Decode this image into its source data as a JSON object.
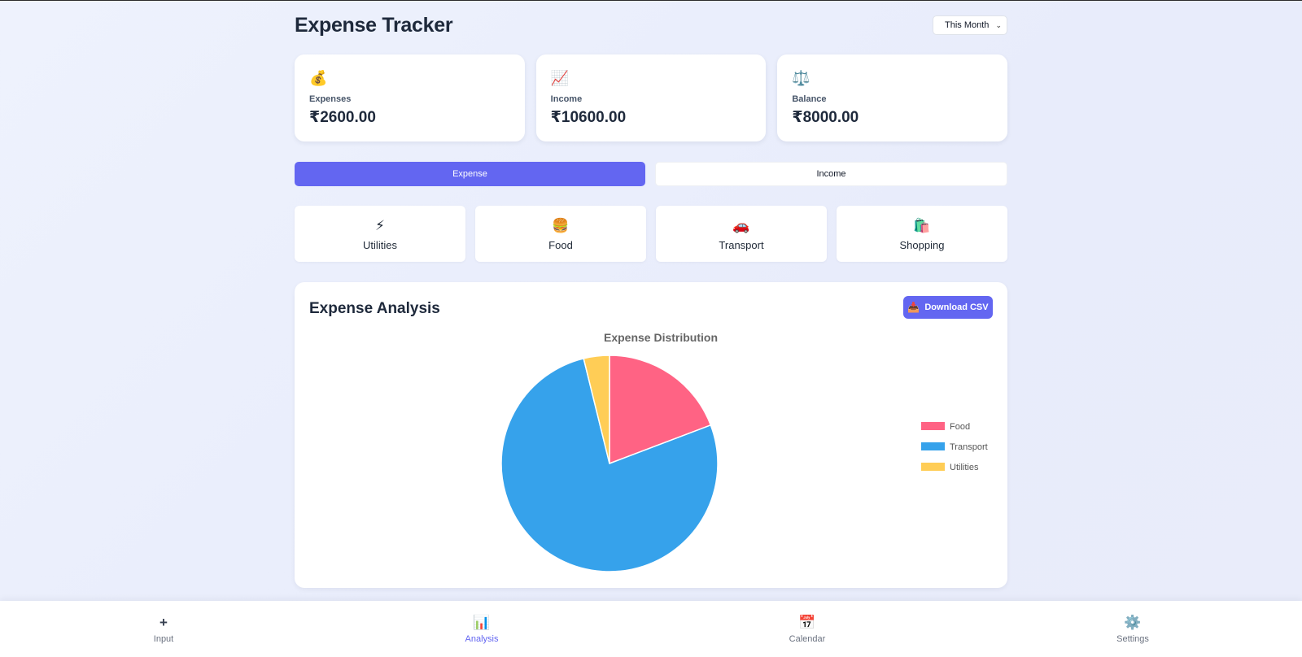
{
  "header": {
    "title": "Expense Tracker",
    "period": "This Month"
  },
  "summary": [
    {
      "icon": "money-bag-icon",
      "emoji": "💰",
      "label": "Expenses",
      "value": "₹2600.00"
    },
    {
      "icon": "chart-increasing-icon",
      "emoji": "📈",
      "label": "Income",
      "value": "₹10600.00"
    },
    {
      "icon": "balance-scale-icon",
      "emoji": "⚖️",
      "label": "Balance",
      "value": "₹8000.00"
    }
  ],
  "type_toggle": {
    "expense_label": "Expense",
    "income_label": "Income",
    "active": "Expense"
  },
  "categories": [
    {
      "icon": "lightning-icon",
      "emoji": "⚡",
      "name": "Utilities"
    },
    {
      "icon": "burger-icon",
      "emoji": "🍔",
      "name": "Food"
    },
    {
      "icon": "car-icon",
      "emoji": "🚗",
      "name": "Transport"
    },
    {
      "icon": "shopping-bags-icon",
      "emoji": "🛍️",
      "name": "Shopping"
    }
  ],
  "analysis": {
    "title": "Expense Analysis",
    "download_label": "Download CSV",
    "download_icon": "inbox-tray-icon",
    "download_emoji": "📥"
  },
  "chart_data": {
    "type": "pie",
    "title": "Expense Distribution",
    "categories": [
      "Food",
      "Transport",
      "Utilities"
    ],
    "values": [
      500,
      2000,
      100
    ],
    "colors": [
      "#ff6384",
      "#36a2eb",
      "#ffcd56"
    ],
    "legend": "right"
  },
  "nav": [
    {
      "icon": "plus-icon",
      "glyph": "+",
      "label": "Input",
      "active": false
    },
    {
      "icon": "bar-chart-icon",
      "glyph": "📊",
      "label": "Analysis",
      "active": true
    },
    {
      "icon": "calendar-icon",
      "glyph": "📅",
      "label": "Calendar",
      "active": false
    },
    {
      "icon": "gear-icon",
      "glyph": "⚙️",
      "label": "Settings",
      "active": false
    }
  ]
}
